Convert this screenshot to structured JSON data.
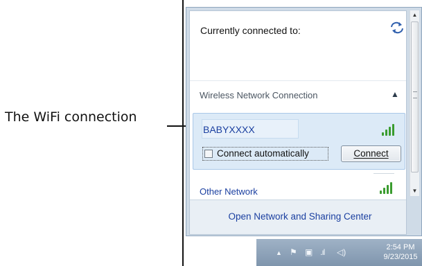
{
  "annotation": {
    "text": "The WiFi connection"
  },
  "popup": {
    "connected_label": "Currently connected to:",
    "refresh_icon": "refresh-icon",
    "section_label": "Wireless Network Connection",
    "network": {
      "name": "BABYXXXX",
      "connect_auto_label": "Connect automatically",
      "connect_auto_checked": false,
      "connect_button_label": "Connect",
      "signal": "signal-bars-icon"
    },
    "other_network_label": "Other Network",
    "footer_link": "Open Network and Sharing Center"
  },
  "taskbar": {
    "time": "2:54 PM",
    "date": "9/23/2015",
    "icons": [
      "show-hidden-icon",
      "flag-icon",
      "network-icon",
      "signal-icon",
      "volume-icon"
    ]
  },
  "colors": {
    "accent": "#1a3fa0",
    "selected_bg": "#dceaf7",
    "taskbar": "#8ea3ba"
  }
}
